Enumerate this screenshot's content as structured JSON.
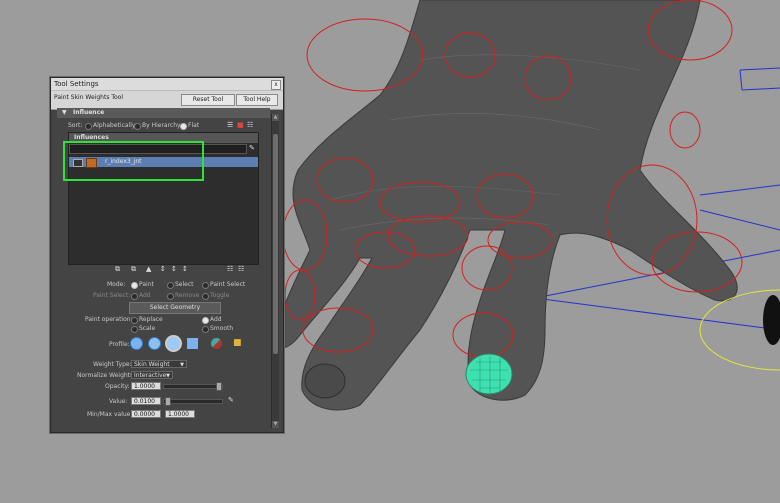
{
  "tool_settings": {
    "title": "Tool Settings",
    "close_glyph": "x",
    "tool_name": "Paint Skin Weights Tool",
    "reset_button": "Reset Tool",
    "help_button": "Tool Help",
    "influence_section": "Influence",
    "sort": {
      "label": "Sort:",
      "options": [
        "Alphabetically",
        "By Hierarchy",
        "Flat"
      ],
      "selected": "Flat"
    },
    "influences": {
      "header": "Influences",
      "items": [
        {
          "name": "r_index3_jnt",
          "selected": true
        }
      ]
    },
    "mode": {
      "label": "Mode:",
      "options": [
        "Paint",
        "Select",
        "Paint Select"
      ],
      "selected": "Paint"
    },
    "paint_select": {
      "label": "Paint Select:",
      "options": [
        "Add",
        "Remove",
        "Toggle"
      ]
    },
    "select_geometry_button": "Select Geometry",
    "paint_operation": {
      "label": "Paint operation:",
      "options": [
        "Replace",
        "Add",
        "Scale",
        "Smooth"
      ],
      "selected": "Add"
    },
    "profile_label": "Profile:",
    "weight_type": {
      "label": "Weight Type:",
      "value": "Skin Weight"
    },
    "normalize_weights": {
      "label": "Normalize Weights:",
      "value": "Interactive"
    },
    "opacity": {
      "label": "Opacity:",
      "value": "1.0000",
      "level": 1.0
    },
    "value": {
      "label": "Value:",
      "value": "0.0100",
      "level": 0.01
    },
    "min_max": {
      "label": "Min/Max value:",
      "min": "0.0000",
      "max": "1.0000"
    }
  },
  "colors": {
    "viewport_bg": "#9c9c9c",
    "panel_bg": "#444444",
    "selection": "#5b7fb2",
    "highlight_box": "#2ee23a",
    "joint_circles": "#d42020",
    "skeleton_lines": "#2233cc",
    "fingertip_paint": "#3fe0b0"
  }
}
